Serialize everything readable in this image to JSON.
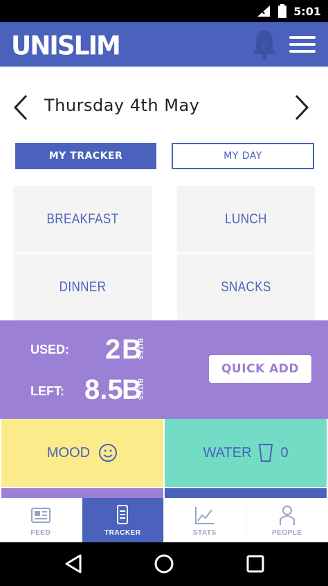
{
  "status_bar": {
    "time": "5:01"
  },
  "app_bar": {
    "logo": "UNISLIM",
    "notification_count": "0"
  },
  "date_nav": {
    "date": "Thursday 4th May"
  },
  "view_toggle": {
    "active": "MY TRACKER",
    "inactive": "MY DAY"
  },
  "meals": {
    "breakfast": "BREAKFAST",
    "lunch": "LUNCH",
    "dinner": "DINNER",
    "snacks": "SNACKS"
  },
  "budget": {
    "used_label": "USED:",
    "used_value": "2",
    "left_label": "LEFT:",
    "left_value": "8.5",
    "unit": "B",
    "unit_sub": "BITES",
    "quick_add": "QUICK ADD"
  },
  "mood": {
    "label": "MOOD"
  },
  "water": {
    "label": "WATER",
    "value": "0"
  },
  "bottom_nav": [
    {
      "label": "FEED"
    },
    {
      "label": "TRACKER"
    },
    {
      "label": "STATS"
    },
    {
      "label": "PEOPLE"
    }
  ],
  "colors": {
    "brand_blue": "#4a62bb",
    "purple": "#9b80d6",
    "mood_yellow": "#fbeb8a",
    "water_teal": "#72dcc4",
    "tile_grey": "#f4f4f5"
  }
}
